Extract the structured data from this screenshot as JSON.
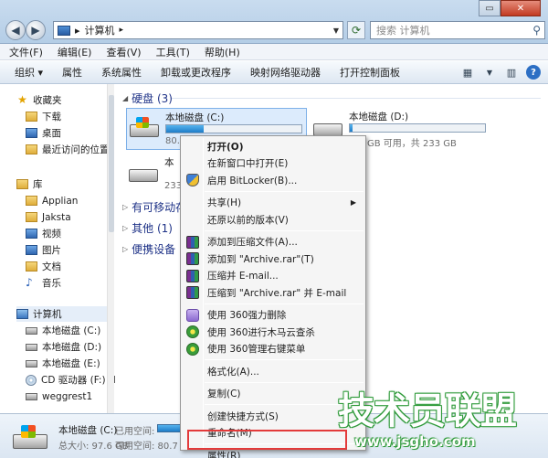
{
  "address_bar": {
    "path_root": "▸",
    "path": "计算机",
    "search_placeholder": "搜索 计算机"
  },
  "menubar": [
    {
      "label": "文件(F)"
    },
    {
      "label": "编辑(E)"
    },
    {
      "label": "查看(V)"
    },
    {
      "label": "工具(T)"
    },
    {
      "label": "帮助(H)"
    }
  ],
  "toolbar": [
    {
      "label": "组织 ▾"
    },
    {
      "label": "属性"
    },
    {
      "label": "系统属性"
    },
    {
      "label": "卸载或更改程序"
    },
    {
      "label": "映射网络驱动器"
    },
    {
      "label": "打开控制面板"
    }
  ],
  "sidebar": {
    "favorites_title": "收藏夹",
    "favorites": [
      {
        "label": "下载"
      },
      {
        "label": "桌面"
      },
      {
        "label": "最近访问的位置"
      }
    ],
    "library_title": "库",
    "library": [
      {
        "label": "Applian"
      },
      {
        "label": "Jaksta"
      },
      {
        "label": "视频"
      },
      {
        "label": "图片"
      },
      {
        "label": "文档"
      },
      {
        "label": "音乐"
      }
    ],
    "computer_title": "计算机",
    "computer": [
      {
        "label": "本地磁盘 (C:)"
      },
      {
        "label": "本地磁盘 (D:)"
      },
      {
        "label": "本地磁盘 (E:)"
      },
      {
        "label": "CD 驱动器 (F:) H"
      },
      {
        "label": "weggrest1"
      }
    ]
  },
  "main": {
    "hard_disks_title": "硬盘 (3)",
    "drives": [
      {
        "name": "本地磁盘 (C:)",
        "free": "80.",
        "fill": 0.28
      },
      {
        "name": "本地磁盘 (D:)",
        "free": "GB 可用，共 233 GB",
        "fill": 0.02
      },
      {
        "name": "本",
        "free": "233",
        "fill": 0.0
      }
    ],
    "groups": [
      {
        "label": "有可移动存"
      },
      {
        "label": "其他 (1)"
      },
      {
        "label": "便携设备"
      }
    ]
  },
  "status": {
    "name": "本地磁盘 (C:)",
    "used_label": "已用空间:",
    "total_label": "总大小: 97.6 GB",
    "free_label": "可用空间: 80.7 G",
    "used_fraction": 0.17
  },
  "context_menu": [
    {
      "label": "打开(O)",
      "bold": true,
      "icon": "none"
    },
    {
      "label": "在新窗口中打开(E)",
      "icon": "none"
    },
    {
      "label": "启用 BitLocker(B)...",
      "icon": "bitlocker-shield-icon"
    },
    {
      "sep": true
    },
    {
      "label": "共享(H)",
      "icon": "none",
      "submenu": true
    },
    {
      "label": "还原以前的版本(V)",
      "icon": "none"
    },
    {
      "sep": true
    },
    {
      "label": "添加到压缩文件(A)...",
      "icon": "winrar-icon"
    },
    {
      "label": "添加到 \"Archive.rar\"(T)",
      "icon": "winrar-icon"
    },
    {
      "label": "压缩并 E-mail...",
      "icon": "winrar-icon"
    },
    {
      "label": "压缩到 \"Archive.rar\" 并 E-mail",
      "icon": "winrar-icon"
    },
    {
      "sep": true
    },
    {
      "label": "使用 360强力删除",
      "icon": "360-erase-icon"
    },
    {
      "label": "使用 360进行木马云查杀",
      "icon": "360-icon"
    },
    {
      "label": "使用 360管理右键菜单",
      "icon": "360-icon"
    },
    {
      "sep": true
    },
    {
      "label": "格式化(A)...",
      "icon": "none"
    },
    {
      "sep": true
    },
    {
      "label": "复制(C)",
      "icon": "none"
    },
    {
      "sep": true
    },
    {
      "label": "创建快捷方式(S)",
      "icon": "none"
    },
    {
      "label": "重命名(M)",
      "icon": "none"
    },
    {
      "sep": true
    },
    {
      "label": "属性(R)",
      "icon": "none"
    }
  ],
  "watermark": {
    "text": "技术员联盟",
    "url": "www.jsgho.com"
  }
}
